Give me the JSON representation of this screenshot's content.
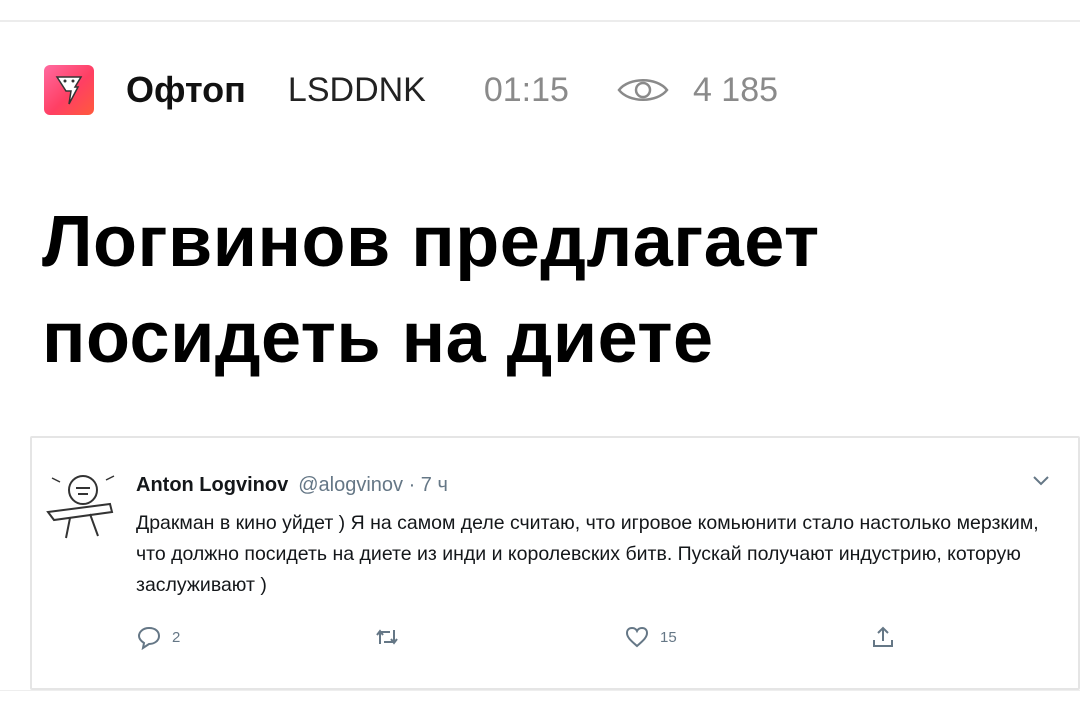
{
  "post": {
    "subsite": "Офтоп",
    "author": "LSDDNK",
    "time": "01:15",
    "views": "4 185",
    "title": "Логвинов предлагает посидеть на диете"
  },
  "tweet": {
    "name": "Anton Logvinov",
    "handle_time": "@alogvinov · 7 ч",
    "text": "Дракман в кино уйдет ) Я на самом деле считаю, что игровое комьюнити стало настолько мерзким, что должно посидеть на диете из инди и королевских битв. Пускай получают индустрию, которую заслуживают )",
    "replies": "2",
    "retweets": "",
    "likes": "15"
  },
  "colors": {
    "accent": "#ff3f63",
    "muted": "#8a8a8a",
    "twitter_gray": "#657786"
  },
  "icons": [
    "subsite-icon",
    "eye-icon",
    "avatar",
    "chevron-down-icon",
    "reply-icon",
    "retweet-icon",
    "like-icon",
    "share-icon"
  ]
}
